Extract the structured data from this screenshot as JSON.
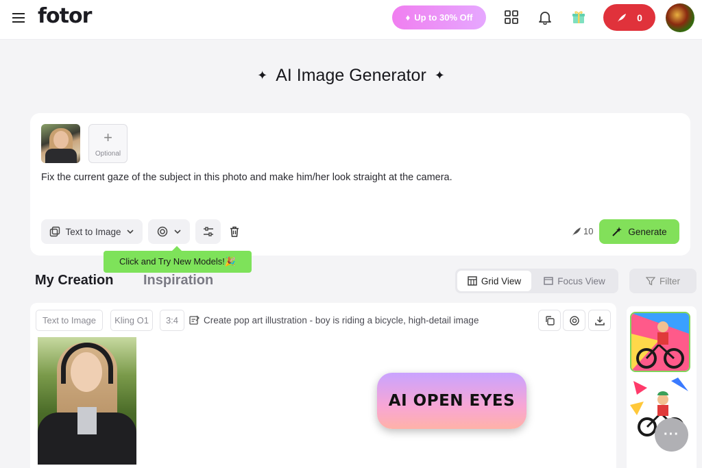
{
  "header": {
    "logo": "fotor",
    "promo_label": "Up to 30% Off",
    "credits": "0"
  },
  "page": {
    "title": "AI Image Generator"
  },
  "prompt_card": {
    "optional_label": "Optional",
    "prompt": "Fix the current gaze of the subject in this photo and make him/her look straight at the camera.",
    "mode_label": "Text to Image",
    "cost": "10",
    "generate_label": "Generate",
    "tooltip": "Click and Try New Models!🎉"
  },
  "tabs": {
    "my_creation": "My Creation",
    "inspiration": "Inspiration",
    "grid_view": "Grid View",
    "focus_view": "Focus View",
    "filter": "Filter"
  },
  "result": {
    "tags": [
      "Text to Image",
      "Kling O1",
      "3:4"
    ],
    "prompt": "Create pop art illustration - boy is riding a bicycle, high-detail image"
  },
  "badge": {
    "text": "AI OPEN EYES"
  },
  "colors": {
    "accent_green": "#82e05a",
    "credit_red": "#e0323b",
    "promo_pink": "#f07ef0"
  }
}
